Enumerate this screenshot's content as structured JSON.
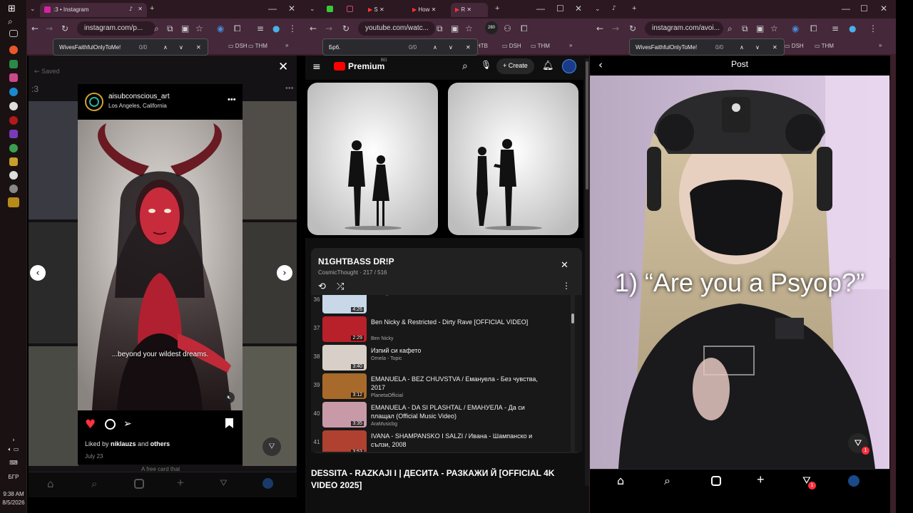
{
  "taskbar": {
    "language": "БГР",
    "time": "9:38 AM",
    "date": "8/5/2026"
  },
  "left_window": {
    "tab_title": ":3 • Instagram",
    "url": "instagram.com/p...",
    "find_query": "WivesFaithfulOnlyToMe!",
    "find_count": "0/0",
    "bookmarks": [
      "DSH",
      "THM"
    ],
    "saved_label": "Saved",
    "collection_name": ":3",
    "post": {
      "username": "aisubconscious_art",
      "location": "Los Angeles, California",
      "caption": "...beyond your wildest dreams.",
      "liked_by_prefix": "Liked by",
      "liked_by_user": "niklauzs",
      "liked_by_and": "and",
      "liked_by_others": "others",
      "date": "July 23"
    },
    "bg_caption": "A free card that"
  },
  "middle_window": {
    "tabs": [
      "S",
      "How",
      "R"
    ],
    "url": "youtube.com/watc...",
    "badge": "280",
    "find_query": "Бр6.",
    "find_count": "0/0",
    "bookmarks": [
      "HTB",
      "DSH",
      "THM"
    ],
    "logo": "Premium",
    "logo_sup": "BG",
    "create_label": "Create",
    "playlist": {
      "title": "N1GHTBASS DR!P",
      "meta": "CosmicThought · 217 / 516",
      "items": [
        {
          "index": "36",
          "duration": "4:26",
          "title": "",
          "channel": "Semargl Band",
          "color": "#c8d8e8"
        },
        {
          "index": "37",
          "duration": "2:29",
          "title": "Ben Nicky & Restricted - Dirty Rave [OFFICIAL VIDEO]",
          "channel": "Ben Nicky",
          "color": "#b8202a"
        },
        {
          "index": "38",
          "duration": "3:40",
          "title": "Изпий си кафето",
          "channel": "Ornela - Topic",
          "color": "#d8d0c8"
        },
        {
          "index": "39",
          "duration": "3:12",
          "title": "EMANUELA - BEZ CHUVSTVA / Емануела - Без чувства, 2017",
          "channel": "PlanetaOfficial",
          "color": "#a86a2a"
        },
        {
          "index": "40",
          "duration": "3:35",
          "title": "EMANUELA - DA SI PLASHTAL / ЕМАНУЕЛА - Да си плащал (Official Music Video)",
          "channel": "AraMusicbg",
          "color": "#c89aa8"
        },
        {
          "index": "41",
          "duration": "3:53",
          "title": "IVANA - SHAMPANSKO I SALZI / Ивана - Шампанско и сълзи, 2008",
          "channel": "",
          "color": "#b04030"
        }
      ]
    },
    "video_title": "DESSITA - RAZKAJI I | ДЕСИТА - РАЗКАЖИ Й [OFFICIAL 4K VIDEO 2025]"
  },
  "right_window": {
    "url": "instagram.com/avoi...",
    "find_query": "WivesFaithfulOnlyToMe!",
    "find_count": "0/0",
    "bookmarks": [
      "DSH",
      "THM"
    ],
    "header_title": "Post",
    "overlay_text": "1) “Are you a Psyop?”",
    "notif_count": "1"
  }
}
